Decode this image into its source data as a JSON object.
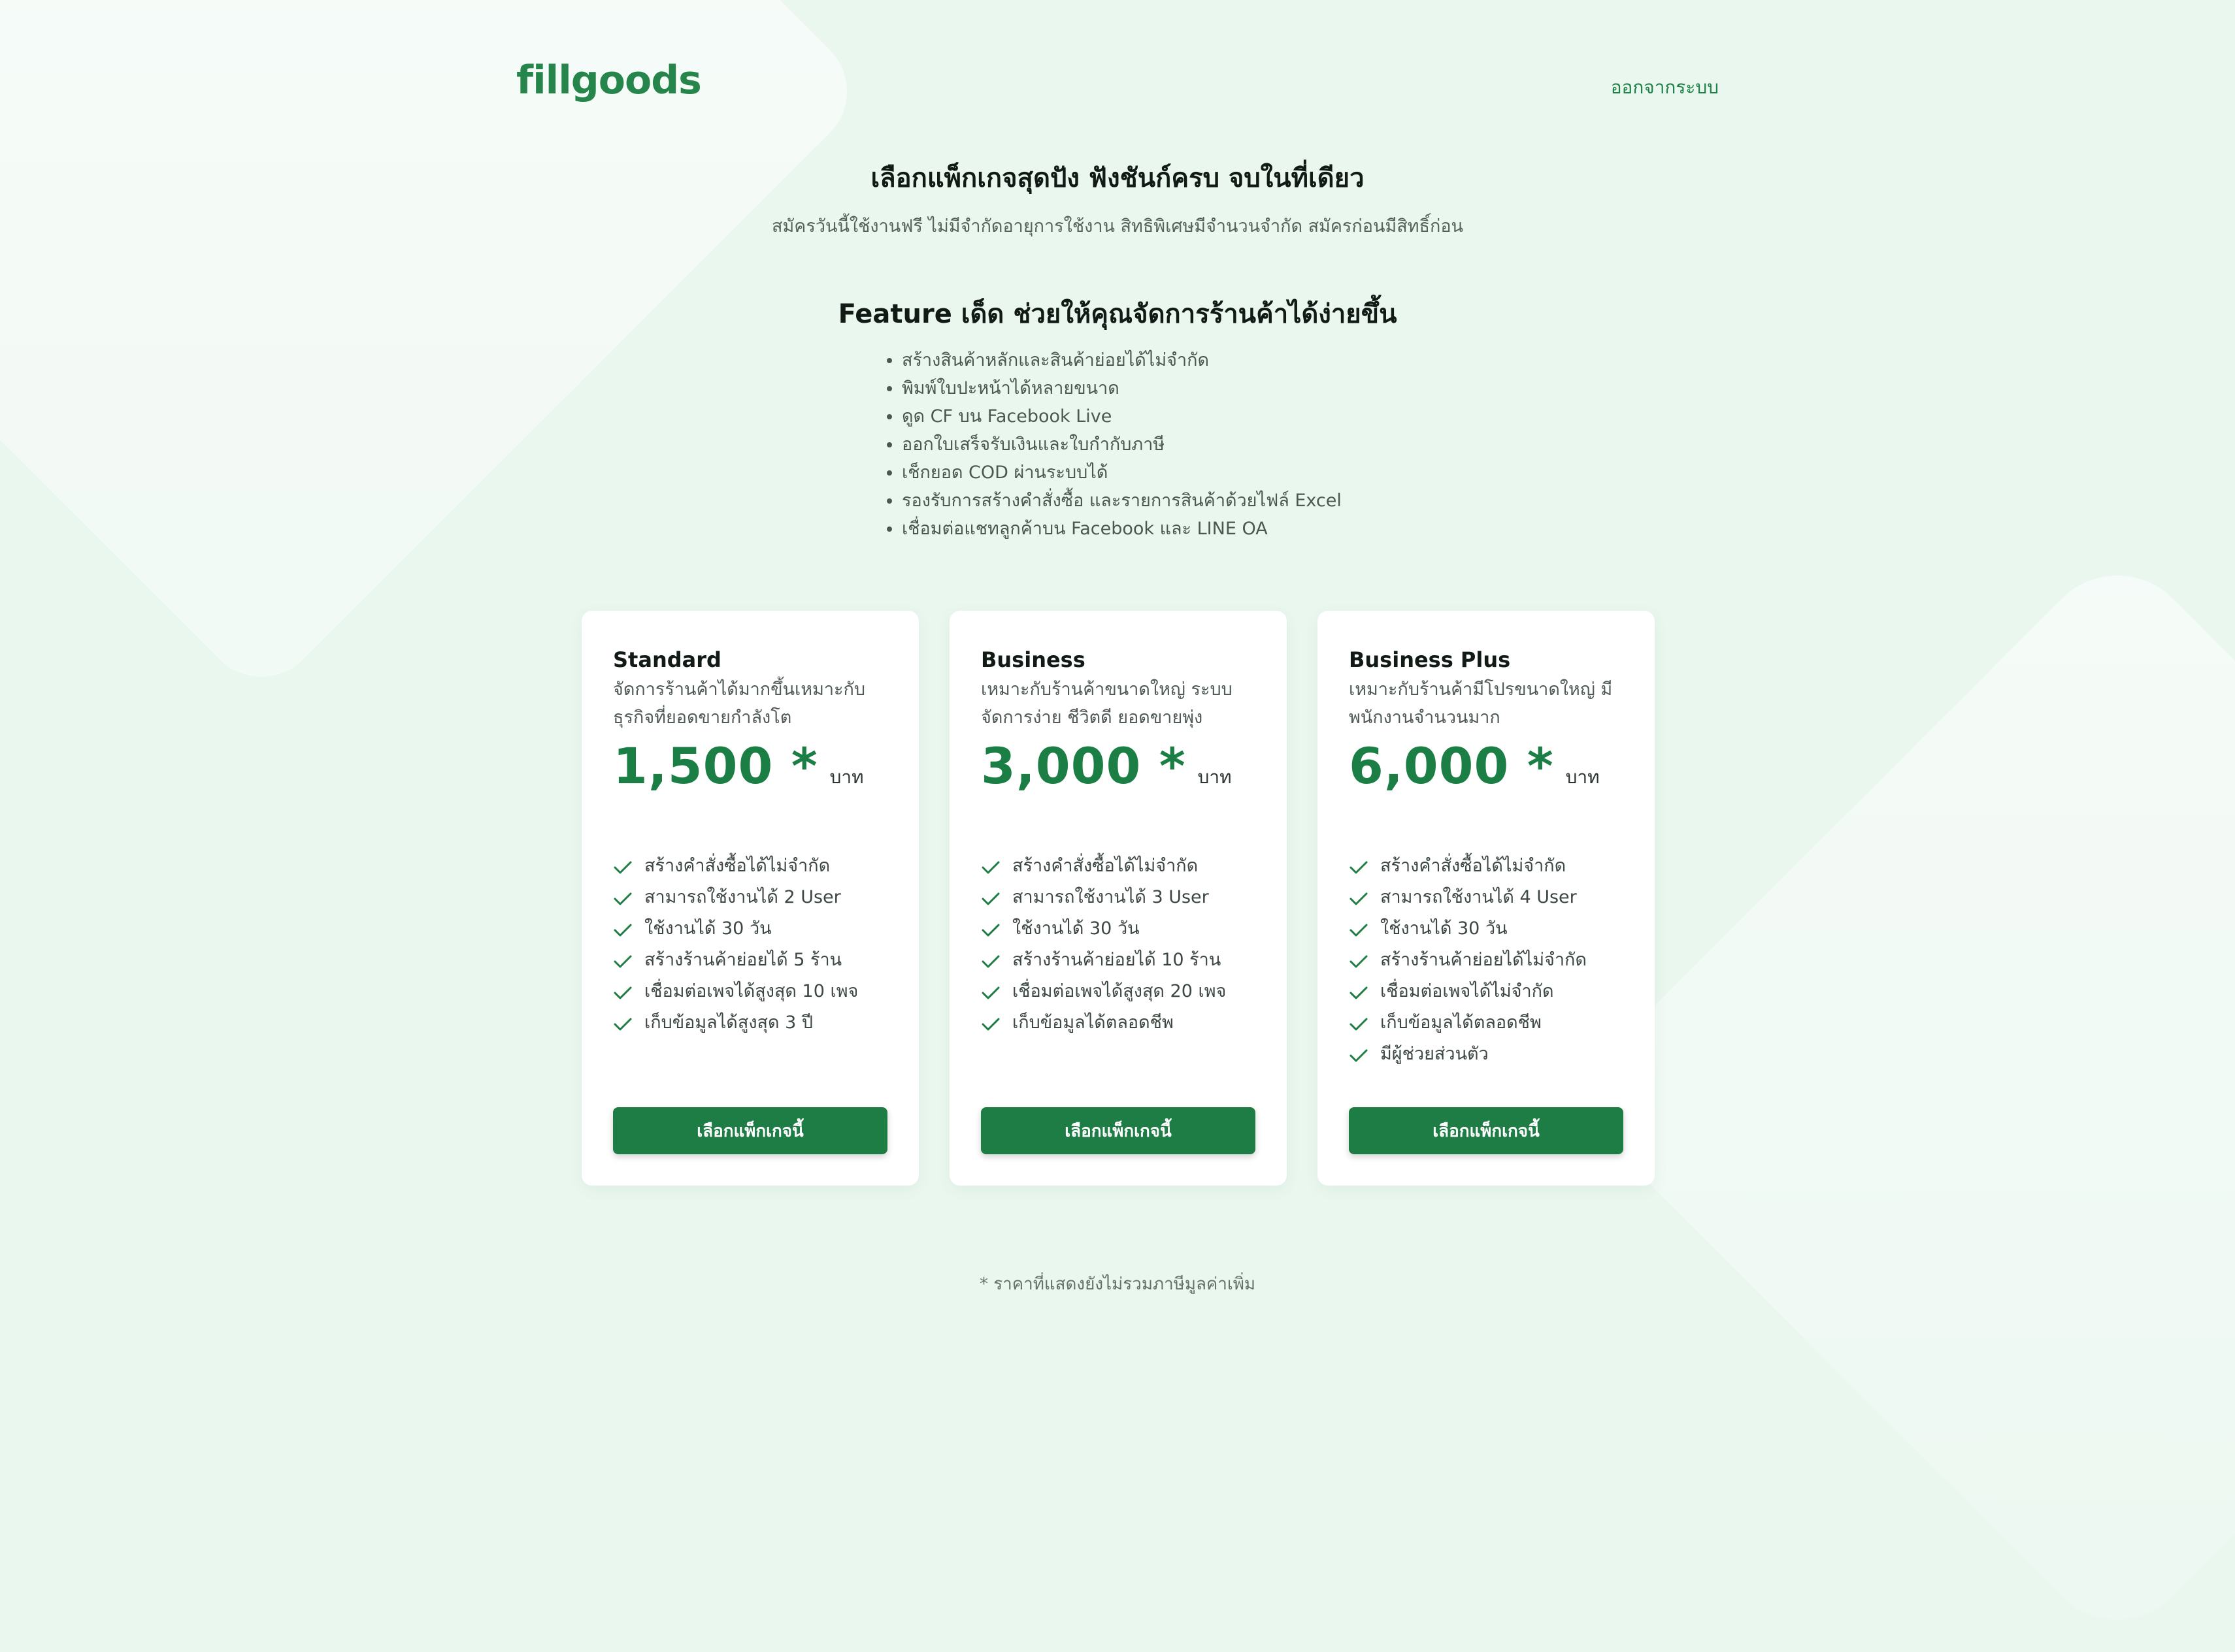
{
  "header": {
    "logo": "fillgoods",
    "logout": "ออกจากระบบ"
  },
  "hero": {
    "title": "เลือกแพ็กเกจสุดปัง ฟังชันก์ครบ จบในที่เดียว",
    "subtitle": "สมัครวันนี้ใช้งานฟรี ไม่มีจำกัดอายุการใช้งาน สิทธิพิเศษมีจำนวนจำกัด สมัครก่อนมีสิทธิ์ก่อน"
  },
  "features": {
    "title": "Feature เด็ด ช่วยให้คุณจัดการร้านค้าได้ง่ายขึ้น",
    "items": [
      "สร้างสินค้าหลักและสินค้าย่อยได้ไม่จำกัด",
      "พิมพ์ใบปะหน้าได้หลายขนาด",
      "ดูด CF บน Facebook Live",
      "ออกใบเสร็จรับเงินและใบกำกับภาษี",
      "เช็กยอด COD ผ่านระบบได้",
      "รองรับการสร้างคำสั่งซื้อ และรายการสินค้าด้วยไฟล์ Excel",
      "เชื่อมต่อแชทลูกค้าบน Facebook และ LINE OA"
    ]
  },
  "plans": [
    {
      "name": "Standard",
      "desc": "จัดการร้านค้าได้มากขึ้นเหมาะกับธุรกิจที่ยอดขายกำลังโต",
      "price": "1,500 *",
      "unit": "บาท",
      "perks": [
        "สร้างคำสั่งซื้อได้ไม่จำกัด",
        "สามารถใช้งานได้ 2 User",
        "ใช้งานได้ 30 วัน",
        "สร้างร้านค้าย่อยได้ 5 ร้าน",
        "เชื่อมต่อเพจได้สูงสุด 10 เพจ",
        "เก็บข้อมูลได้สูงสุด 3 ปี"
      ],
      "button": "เลือกแพ็กเกจนี้"
    },
    {
      "name": "Business",
      "desc": "เหมาะกับร้านค้าขนาดใหญ่ ระบบจัดการง่าย ชีวิตดี ยอดขายพุ่ง",
      "price": "3,000 *",
      "unit": "บาท",
      "perks": [
        "สร้างคำสั่งซื้อได้ไม่จำกัด",
        "สามารถใช้งานได้ 3 User",
        "ใช้งานได้ 30 วัน",
        "สร้างร้านค้าย่อยได้ 10 ร้าน",
        "เชื่อมต่อเพจได้สูงสุด 20 เพจ",
        "เก็บข้อมูลได้ตลอดชีพ"
      ],
      "button": "เลือกแพ็กเกจนี้"
    },
    {
      "name": "Business Plus",
      "desc": "เหมาะกับร้านค้ามีโปรขนาดใหญ่ มีพนักงานจำนวนมาก",
      "price": "6,000 *",
      "unit": "บาท",
      "perks": [
        "สร้างคำสั่งซื้อได้ไม่จำกัด",
        "สามารถใช้งานได้ 4 User",
        "ใช้งานได้ 30 วัน",
        "สร้างร้านค้าย่อยได้ไม่จำกัด",
        "เชื่อมต่อเพจได้ไม่จำกัด",
        "เก็บข้อมูลได้ตลอดชีพ",
        "มีผู้ช่วยส่วนตัว"
      ],
      "button": "เลือกแพ็กเกจนี้"
    }
  ],
  "footnote": "* ราคาที่แสดงยังไม่รวมภาษีมูลค่าเพิ่ม",
  "colors": {
    "brand": "#1d7d45",
    "background": "#eaf7ef"
  },
  "icons": {
    "perk": "check-icon"
  }
}
